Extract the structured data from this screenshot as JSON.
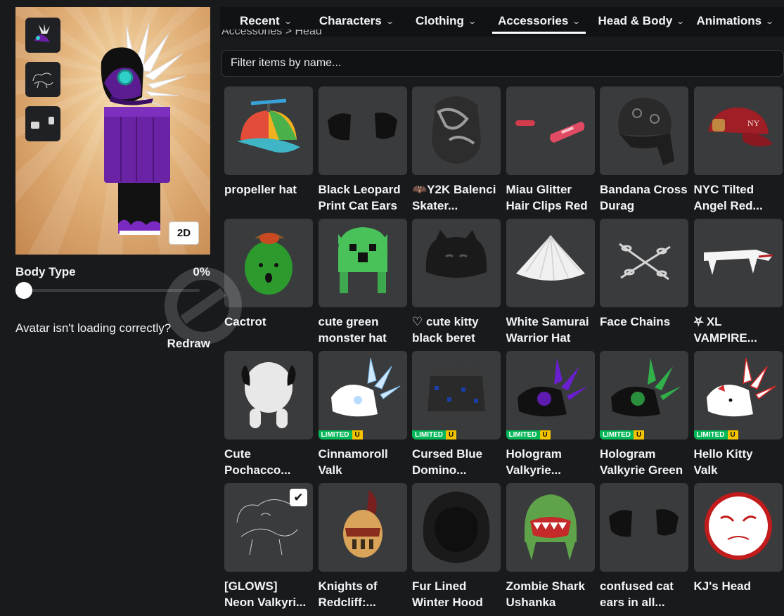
{
  "avatar": {
    "view_toggle_label": "2D",
    "body_type_label": "Body Type",
    "body_type_value": "0%",
    "body_type_fraction": 0,
    "loading_question": "Avatar isn't loading correctly?",
    "redraw_label": "Redraw",
    "equipped_thumbs": [
      "valkyrie-headdress-icon",
      "neon-outline-icon",
      "sparkle-clips-icon"
    ]
  },
  "nav": {
    "tabs": [
      {
        "label": "Recent",
        "active": false
      },
      {
        "label": "Characters",
        "active": false
      },
      {
        "label": "Clothing",
        "active": false
      },
      {
        "label": "Accessories",
        "active": true
      },
      {
        "label": "Head & Body",
        "active": false
      },
      {
        "label": "Animations",
        "active": false
      }
    ]
  },
  "breadcrumb": "Accessories > Head",
  "search": {
    "placeholder": "Filter items by name..."
  },
  "items": [
    {
      "line1": "propeller hat",
      "line2": "",
      "icon": "propeller-hat-icon",
      "limited": false,
      "selected": false
    },
    {
      "line1": "Black Leopard",
      "line2": "Print Cat Ears",
      "icon": "cat-ears-icon",
      "limited": false,
      "selected": false
    },
    {
      "line1": "🦇Y2K Balenci",
      "line2": "Skater...",
      "icon": "skater-hood-icon",
      "limited": false,
      "selected": false
    },
    {
      "line1": "Miau Glitter",
      "line2": "Hair Clips Red",
      "icon": "hair-clips-icon",
      "limited": false,
      "selected": false
    },
    {
      "line1": "Bandana Cross",
      "line2": "Durag",
      "icon": "durag-icon",
      "limited": false,
      "selected": false
    },
    {
      "line1": "NYC Tilted",
      "line2": "Angel Red...",
      "icon": "cap-icon",
      "limited": false,
      "selected": false
    },
    {
      "line1": "Cactrot",
      "line2": "",
      "icon": "cactus-head-icon",
      "limited": false,
      "selected": false
    },
    {
      "line1": "cute green",
      "line2": "monster hat",
      "icon": "monster-hat-icon",
      "limited": false,
      "selected": false
    },
    {
      "line1": "♡ cute kitty",
      "line2": "black beret",
      "icon": "kitty-beret-icon",
      "limited": false,
      "selected": false
    },
    {
      "line1": "White Samurai",
      "line2": "Warrior Hat",
      "icon": "samurai-hat-icon",
      "limited": false,
      "selected": false
    },
    {
      "line1": "Face Chains",
      "line2": "",
      "icon": "chains-icon",
      "limited": false,
      "selected": false
    },
    {
      "line1": "⛧ XL",
      "line2": "VAMPIRE...",
      "icon": "vampire-fangs-icon",
      "limited": false,
      "selected": false
    },
    {
      "line1": "Cute",
      "line2": "Pochacco...",
      "icon": "pochacco-hood-icon",
      "limited": false,
      "selected": false
    },
    {
      "line1": "Cinnamoroll",
      "line2": "Valk",
      "icon": "cinnamoroll-valk-icon",
      "limited": true,
      "selected": false
    },
    {
      "line1": "Cursed Blue",
      "line2": "Domino...",
      "icon": "domino-crown-icon",
      "limited": true,
      "selected": false
    },
    {
      "line1": "Hologram",
      "line2": "Valkyrie...",
      "icon": "purple-valk-icon",
      "limited": true,
      "selected": false
    },
    {
      "line1": "Hologram",
      "line2": "Valkyrie Green",
      "icon": "green-valk-icon",
      "limited": true,
      "selected": false
    },
    {
      "line1": "Hello Kitty",
      "line2": "Valk",
      "icon": "hello-kitty-valk-icon",
      "limited": true,
      "selected": false
    },
    {
      "line1": "[GLOWS]",
      "line2": "Neon Valkyri...",
      "icon": "neon-outline-icon",
      "limited": false,
      "selected": true
    },
    {
      "line1": "Knights of",
      "line2": "Redcliff:...",
      "icon": "knight-helmet-icon",
      "limited": false,
      "selected": false
    },
    {
      "line1": "Fur Lined",
      "line2": "Winter Hood",
      "icon": "fur-hood-icon",
      "limited": false,
      "selected": false
    },
    {
      "line1": "Zombie Shark",
      "line2": "Ushanka",
      "icon": "shark-ushanka-icon",
      "limited": false,
      "selected": false
    },
    {
      "line1": "confused cat",
      "line2": "ears in all...",
      "icon": "cat-ears-icon",
      "limited": false,
      "selected": false
    },
    {
      "line1": "KJ's Head",
      "line2": "",
      "icon": "kj-head-icon",
      "limited": false,
      "selected": false
    }
  ],
  "badges": {
    "limited": "LIMITED",
    "unique": "U",
    "check": "✔"
  },
  "colors": {
    "background": "#191a1c",
    "card": "#393b3d",
    "limited": "#02b757",
    "unique": "#f5c400"
  }
}
